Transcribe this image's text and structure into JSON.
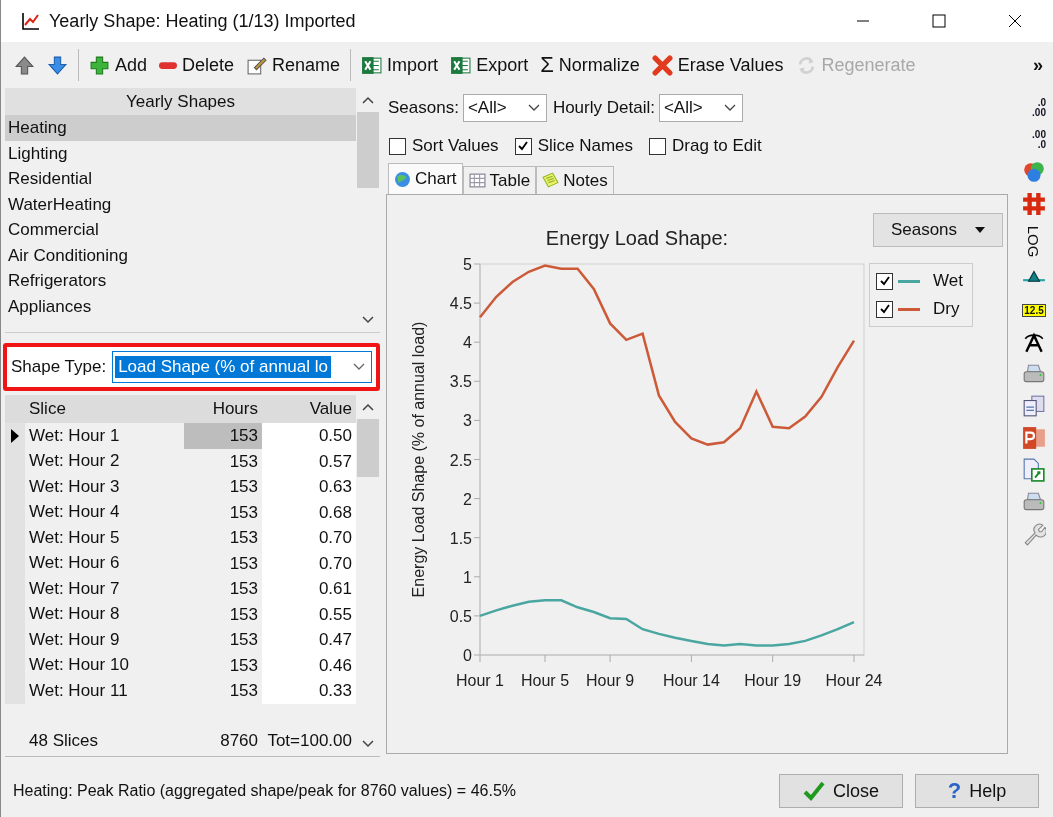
{
  "window": {
    "title": "Yearly Shape: Heating (1/13) Imported"
  },
  "toolbar": [
    {
      "kind": "up",
      "disabled": false
    },
    {
      "kind": "down",
      "disabled": false
    },
    {
      "kind": "add",
      "label": "Add",
      "disabled": false
    },
    {
      "kind": "delete",
      "label": "Delete",
      "disabled": false
    },
    {
      "kind": "rename",
      "label": "Rename",
      "disabled": false
    },
    {
      "kind": "excel",
      "label": "Import",
      "disabled": false
    },
    {
      "kind": "excel",
      "label": "Export",
      "disabled": false
    },
    {
      "kind": "sigma",
      "icon_char": "Σ",
      "label": "Normalize",
      "disabled": false
    },
    {
      "kind": "erase",
      "label": "Erase Values",
      "disabled": false
    },
    {
      "kind": "regenerate",
      "label": "Regenerate",
      "disabled": true
    }
  ],
  "toolbar_overflow": "»",
  "shapes_list": {
    "header": "Yearly Shapes",
    "items": [
      {
        "label": "Heating",
        "selected": true
      },
      {
        "label": "Lighting",
        "selected": false
      },
      {
        "label": "Residential",
        "selected": false
      },
      {
        "label": "WaterHeating",
        "selected": false
      },
      {
        "label": "Commercial",
        "selected": false
      },
      {
        "label": "Air Conditioning",
        "selected": false
      },
      {
        "label": "Refrigerators",
        "selected": false
      },
      {
        "label": "Appliances",
        "selected": false
      }
    ]
  },
  "shape_type": {
    "label": "Shape Type:",
    "value": "Load Shape (% of annual lo"
  },
  "slices_table": {
    "columns": [
      "Slice",
      "Hours",
      "Value"
    ],
    "rows": [
      {
        "slice": "Wet: Hour 1",
        "hours": "153",
        "value": "0.50",
        "current": true
      },
      {
        "slice": "Wet: Hour 2",
        "hours": "153",
        "value": "0.57",
        "current": false
      },
      {
        "slice": "Wet: Hour 3",
        "hours": "153",
        "value": "0.63",
        "current": false
      },
      {
        "slice": "Wet: Hour 4",
        "hours": "153",
        "value": "0.68",
        "current": false
      },
      {
        "slice": "Wet: Hour 5",
        "hours": "153",
        "value": "0.70",
        "current": false
      },
      {
        "slice": "Wet: Hour 6",
        "hours": "153",
        "value": "0.70",
        "current": false
      },
      {
        "slice": "Wet: Hour 7",
        "hours": "153",
        "value": "0.61",
        "current": false
      },
      {
        "slice": "Wet: Hour 8",
        "hours": "153",
        "value": "0.55",
        "current": false
      },
      {
        "slice": "Wet: Hour 9",
        "hours": "153",
        "value": "0.47",
        "current": false
      },
      {
        "slice": "Wet: Hour 10",
        "hours": "153",
        "value": "0.46",
        "current": false
      },
      {
        "slice": "Wet: Hour 11",
        "hours": "153",
        "value": "0.33",
        "current": false
      }
    ],
    "footer": {
      "count": "48 Slices",
      "hours": "8760",
      "total": "Tot=100.00"
    }
  },
  "filters": [
    {
      "label": "Seasons:",
      "value": "<All>"
    },
    {
      "label": "Hourly Detail:",
      "value": "<All>"
    }
  ],
  "options": [
    {
      "label": "Sort Values",
      "checked": false
    },
    {
      "label": "Slice Names",
      "checked": true
    },
    {
      "label": "Drag to Edit",
      "checked": false
    }
  ],
  "tabs": [
    {
      "kind": "chart",
      "label": "Chart",
      "selected": true
    },
    {
      "kind": "table",
      "label": "Table",
      "selected": false
    },
    {
      "kind": "notes",
      "label": "Notes",
      "selected": false
    }
  ],
  "chart": {
    "menu_button": "Seasons",
    "legend": [
      {
        "checked": true
      },
      {
        "checked": true
      }
    ],
    "chart_data": {
      "type": "line",
      "title": "Energy Load Shape:",
      "ylabel": "Energy Load Shape (% of annual load)",
      "categories": [
        "Hour 1",
        null,
        null,
        null,
        "Hour 5",
        null,
        null,
        null,
        "Hour 9",
        null,
        null,
        null,
        null,
        "Hour 14",
        null,
        null,
        null,
        null,
        "Hour 19",
        null,
        null,
        null,
        null,
        "Hour 24"
      ],
      "ylim": [
        0,
        5
      ],
      "yticks": [
        0,
        0.5,
        1,
        1.5,
        2,
        2.5,
        3,
        3.5,
        4,
        4.5,
        5
      ],
      "series": [
        {
          "name": "Wet",
          "color": "#4aa6a0",
          "values": [
            0.5,
            0.57,
            0.63,
            0.68,
            0.7,
            0.7,
            0.61,
            0.55,
            0.47,
            0.46,
            0.33,
            0.27,
            0.22,
            0.18,
            0.14,
            0.12,
            0.14,
            0.12,
            0.12,
            0.14,
            0.18,
            0.25,
            0.33,
            0.42
          ]
        },
        {
          "name": "Dry",
          "color": "#cc5a38",
          "values": [
            4.32,
            4.58,
            4.77,
            4.9,
            4.98,
            4.94,
            4.94,
            4.68,
            4.24,
            4.03,
            4.11,
            3.32,
            2.98,
            2.77,
            2.69,
            2.72,
            2.9,
            3.37,
            2.92,
            2.9,
            3.05,
            3.3,
            3.68,
            4.02
          ]
        }
      ]
    }
  },
  "side_toolbar": [
    {
      "kind": "decimals_less",
      "lines": [
        ".0",
        ".00"
      ]
    },
    {
      "kind": "decimals_more",
      "lines": [
        ".00",
        ".0"
      ]
    },
    {
      "kind": "colors"
    },
    {
      "kind": "grid"
    },
    {
      "kind": "log",
      "label": "LOG"
    },
    {
      "kind": "marker"
    },
    {
      "kind": "value_label",
      "label": "12.5"
    },
    {
      "kind": "font"
    },
    {
      "kind": "print"
    },
    {
      "kind": "copy"
    },
    {
      "kind": "powerpoint"
    },
    {
      "kind": "export"
    },
    {
      "kind": "print"
    },
    {
      "kind": "settings"
    }
  ],
  "status": "Heating: Peak Ratio (aggregated shape/peak for 8760 values) = 46.5%",
  "buttons": [
    {
      "kind": "close",
      "label": "Close"
    },
    {
      "kind": "help",
      "icon_char": "?",
      "label": "Help"
    }
  ]
}
